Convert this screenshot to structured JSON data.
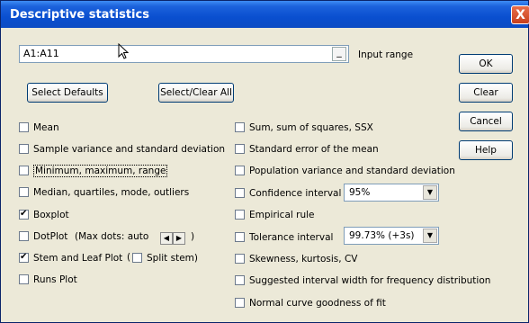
{
  "window": {
    "title": "Descriptive statistics",
    "close_glyph": "X"
  },
  "input": {
    "value": "A1:A11",
    "dash": "_",
    "label": "Input range"
  },
  "buttons": {
    "select_defaults": "Select Defaults",
    "select_clear_all": "Select/Clear All",
    "ok": "OK",
    "clear": "Clear",
    "cancel": "Cancel",
    "help": "Help"
  },
  "left_options": [
    {
      "label": "Mean",
      "checked": false
    },
    {
      "label": "Sample variance and standard deviation",
      "checked": false
    },
    {
      "label": "Minimum, maximum, range",
      "checked": false
    },
    {
      "label": "Median, quartiles, mode, outliers",
      "checked": false
    },
    {
      "label": "Boxplot",
      "checked": true
    },
    {
      "label": "DotPlot",
      "checked": false
    },
    {
      "label": "Stem and Leaf Plot",
      "checked": true
    },
    {
      "label": "Runs Plot",
      "checked": false
    }
  ],
  "dotplot_extra": {
    "text": "(Max dots: auto",
    "close_paren": ")"
  },
  "stem_extra": {
    "open_paren": "(",
    "split_label": "Split stem)",
    "split_checked": false
  },
  "right_options": [
    {
      "label": "Sum, sum of squares, SSX",
      "checked": false
    },
    {
      "label": "Standard error of the mean",
      "checked": false
    },
    {
      "label": "Population variance and standard deviation",
      "checked": false
    },
    {
      "label": "Confidence interval",
      "checked": false
    },
    {
      "label": "Empirical rule",
      "checked": false
    },
    {
      "label": "Tolerance interval",
      "checked": false
    },
    {
      "label": "Skewness, kurtosis, CV",
      "checked": false
    },
    {
      "label": "Suggested interval width for frequency distribution",
      "checked": false
    },
    {
      "label": "Normal curve goodness of fit",
      "checked": false
    }
  ],
  "confidence_select": {
    "value": "95%"
  },
  "tolerance_select": {
    "value": "99.73% (+3s)"
  },
  "colors": {
    "title_bar": "#0a4fd0",
    "dialog": "#ece9d8"
  }
}
